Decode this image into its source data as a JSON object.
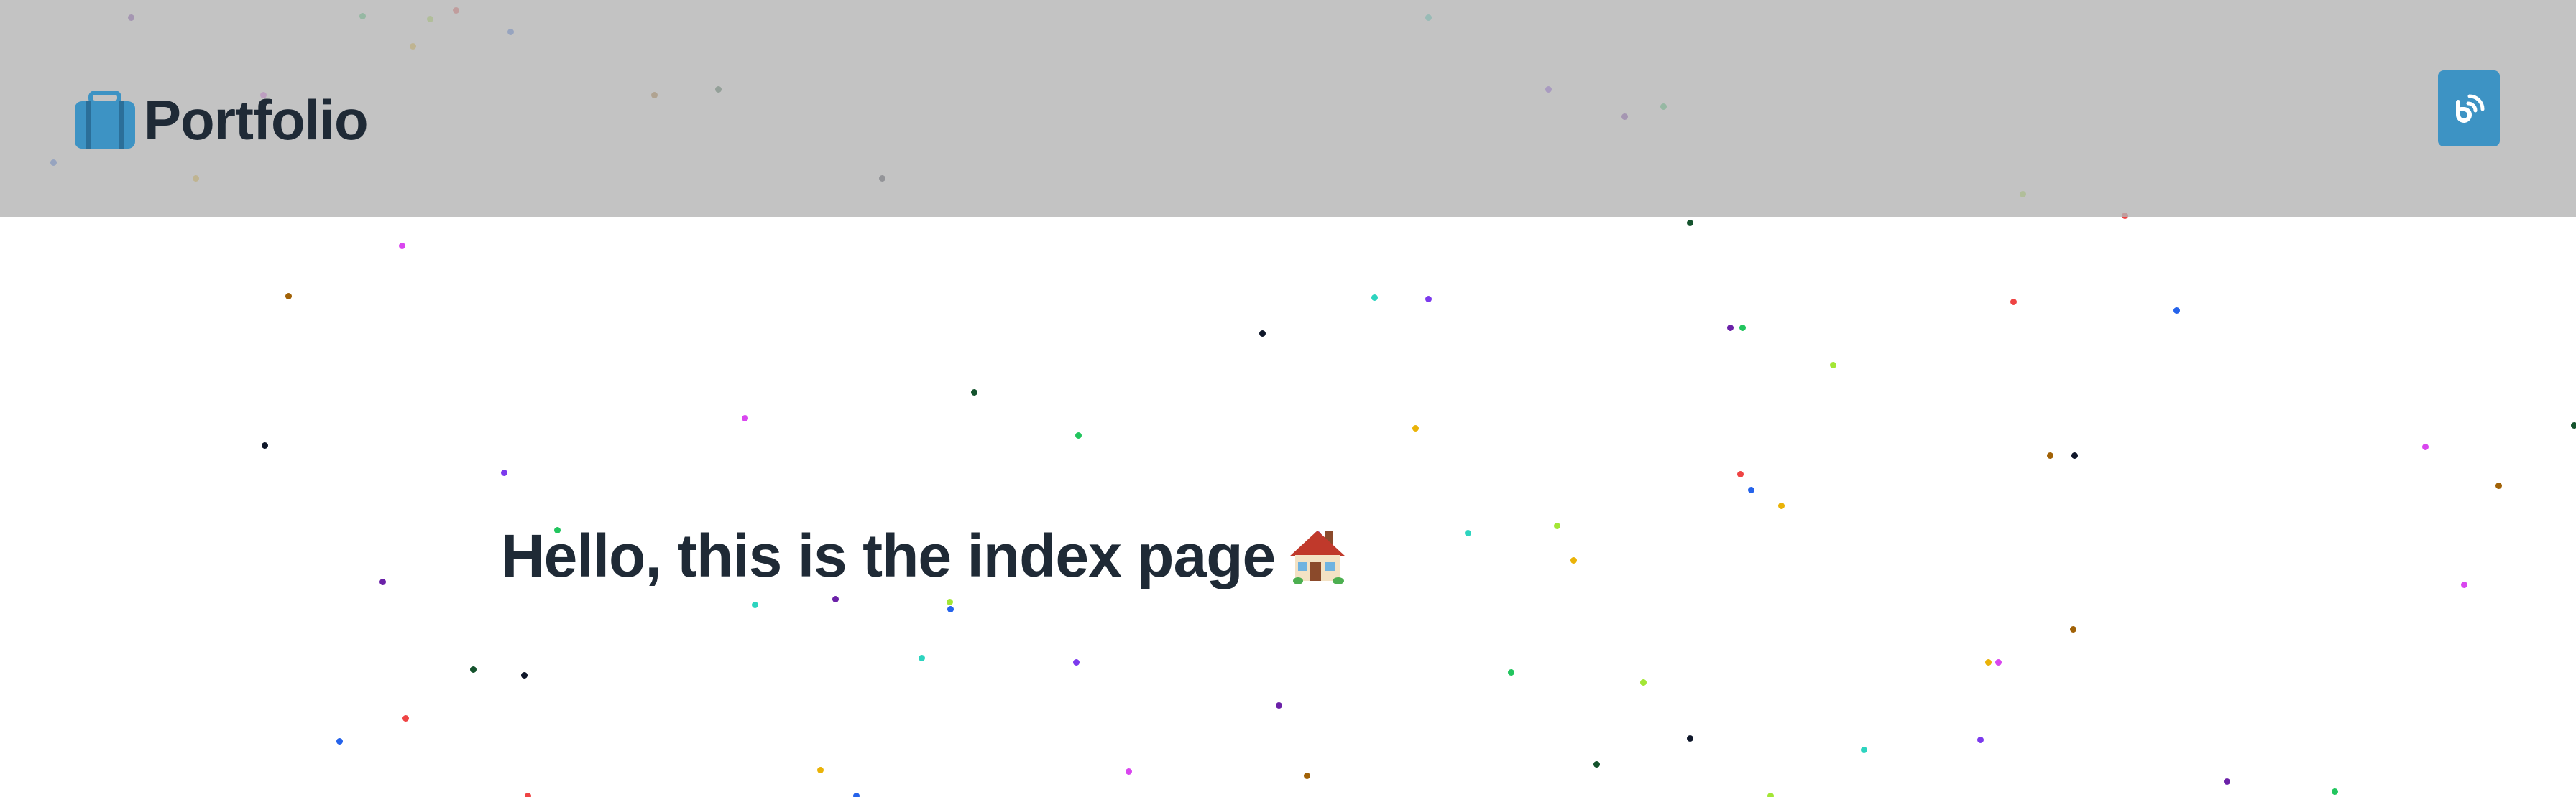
{
  "header": {
    "brand_label": "Portfolio",
    "brand_icon": "briefcase-icon",
    "rss_icon": "rss-icon",
    "accent_color": "#3d93c4",
    "background_color": "#b4b4b4"
  },
  "main": {
    "headline": "Hello, this is the index page",
    "headline_icon": "house-icon",
    "text_color": "#1f2a36"
  },
  "decoration": {
    "confetti_colors": [
      "#6b21a8",
      "#22c55e",
      "#a3e635",
      "#ef4444",
      "#2563eb",
      "#eab308",
      "#d946ef",
      "#a16207",
      "#14532d",
      "#0f172a",
      "#2dd4bf",
      "#7c3aed"
    ]
  }
}
